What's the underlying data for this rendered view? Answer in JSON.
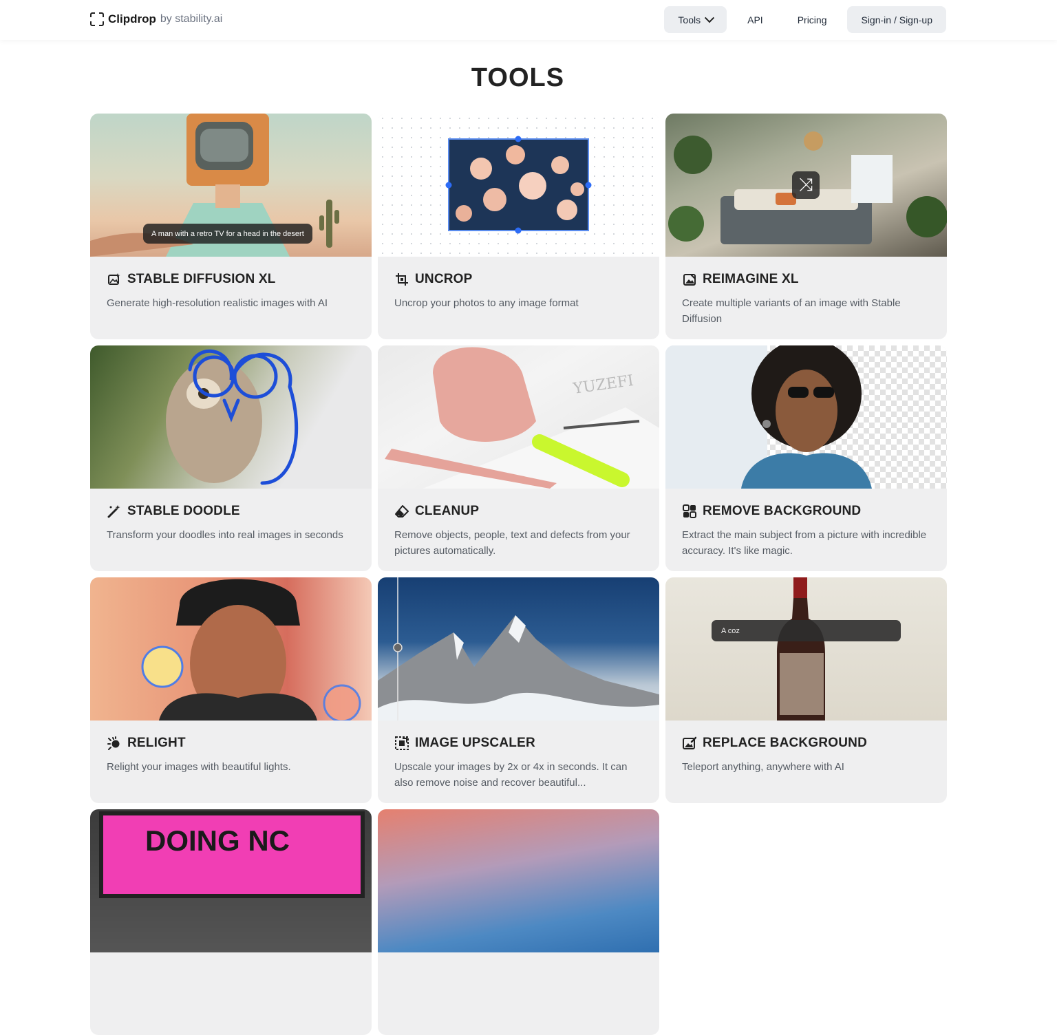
{
  "header": {
    "logo_name": "Clipdrop",
    "logo_by": "by stability.ai",
    "nav": {
      "tools": "Tools",
      "api": "API",
      "pricing": "Pricing",
      "signin": "Sign-in / Sign-up"
    }
  },
  "page_title": "TOOLS",
  "tools": [
    {
      "title": "STABLE DIFFUSION XL",
      "desc": "Generate high-resolution realistic images with AI",
      "icon": "image-sparkle-icon",
      "thumb_caption": "A man with a retro TV for a head in the desert"
    },
    {
      "title": "UNCROP",
      "desc": "Uncrop your photos to any image format",
      "icon": "crop-icon"
    },
    {
      "title": "REIMAGINE XL",
      "desc": "Create multiple variants of an image with Stable Diffusion",
      "icon": "image-variants-icon"
    },
    {
      "title": "STABLE DOODLE",
      "desc": "Transform your doodles into real images in seconds",
      "icon": "magic-wand-icon"
    },
    {
      "title": "CLEANUP",
      "desc": "Remove objects, people, text and defects from your pictures automatically.",
      "icon": "eraser-icon"
    },
    {
      "title": "REMOVE BACKGROUND",
      "desc": "Extract the main subject from a picture with incredible accuracy. It's like magic.",
      "icon": "remove-background-icon"
    },
    {
      "title": "RELIGHT",
      "desc": "Relight your images with beautiful lights.",
      "icon": "light-bulb-icon"
    },
    {
      "title": "IMAGE UPSCALER",
      "desc": "Upscale your images by 2x or 4x in seconds. It can also remove noise and recover beautiful...",
      "icon": "upscale-icon"
    },
    {
      "title": "REPLACE BACKGROUND",
      "desc": "Teleport anything, anywhere with AI",
      "icon": "replace-background-icon",
      "thumb_caption": "A coz"
    }
  ],
  "partial_row": {
    "billboard_text": "DOING NC"
  }
}
